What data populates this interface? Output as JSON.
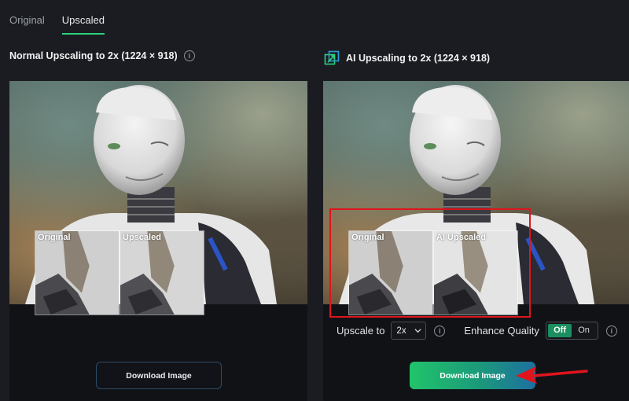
{
  "tabs": [
    {
      "label": "Original",
      "active": false
    },
    {
      "label": "Upscaled",
      "active": true
    }
  ],
  "left_panel": {
    "title": "Normal Upscaling to 2x (1224 × 918)",
    "crop_labels": [
      "Original",
      "Upscaled"
    ],
    "download_label": "Download Image"
  },
  "right_panel": {
    "title": "AI Upscaling to 2x (1224 × 918)",
    "crop_labels": [
      "Original",
      "AI Upscaled"
    ],
    "upscale_label": "Upscale to",
    "upscale_value": "2x",
    "enhance_label": "Enhance Quality",
    "toggle_off": "Off",
    "toggle_on": "On",
    "toggle_selected": "Off",
    "download_label": "Download Image"
  },
  "icons": {
    "info": "info-icon",
    "ai": "ai-upscale-icon",
    "chevron": "chevron-down-icon"
  },
  "colors": {
    "accent_green": "#2bd17e",
    "annotation_red": "#e0141c",
    "button_gradient_start": "#21c46b",
    "button_gradient_end": "#1e6fa0"
  }
}
